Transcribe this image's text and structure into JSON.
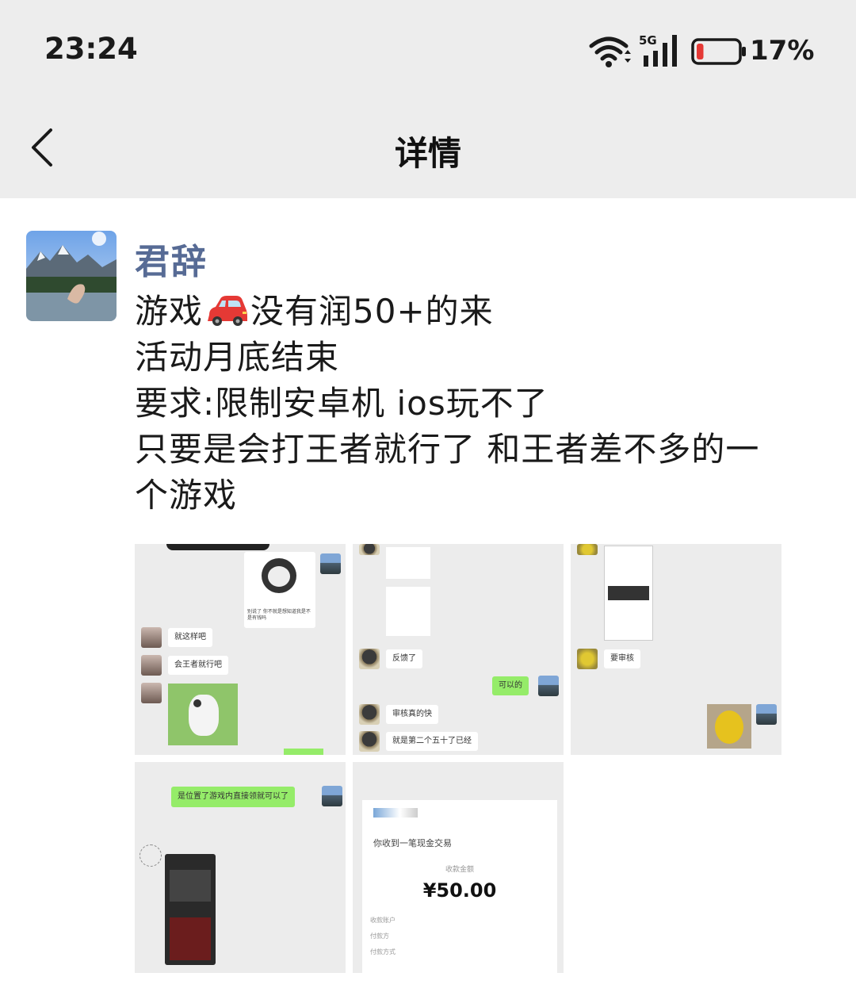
{
  "status_bar": {
    "time": "23:24",
    "network": "5G",
    "battery_percent": "17%",
    "battery_level": 0.17,
    "icons": [
      "wifi-icon",
      "signal-icon",
      "battery-icon"
    ]
  },
  "header": {
    "title": "详情",
    "back_icon": "chevron-left-icon"
  },
  "post": {
    "author": "君辞",
    "lines": [
      {
        "before": "游戏",
        "emoji": "car-emoji",
        "after": "没有润50+的来"
      },
      "活动月底结束",
      "要求:限制安卓机 ios玩不了",
      "只要是会打王者就行了 和王者差不多的一",
      "个游戏"
    ],
    "images": [
      {
        "kind": "chat-screenshot",
        "bubbles": [
          "就这样吧",
          "会王者就行吧"
        ],
        "sticker_caption": "别说了 你不就是想知道我是不是有钱吗"
      },
      {
        "kind": "chat-screenshot",
        "bubbles": [
          "反馈了",
          "可以的",
          "审核真的快",
          "就是第二个五十了已经"
        ]
      },
      {
        "kind": "chat-screenshot",
        "bubbles": [
          "要审核"
        ]
      },
      {
        "kind": "chat-screenshot",
        "bubbles": [
          "是位置了游戏内直接领就可以了"
        ]
      },
      {
        "kind": "payment-receipt",
        "title": "你收到一笔现金交易",
        "amount_label": "收款金额",
        "amount": "¥50.00",
        "rows": [
          "收款账户",
          "付款方",
          "付款方式"
        ]
      }
    ]
  },
  "colors": {
    "header_bg": "#ededed",
    "author_name": "#576b95",
    "wechat_green": "#95ec69",
    "battery_low": "#e53935"
  }
}
